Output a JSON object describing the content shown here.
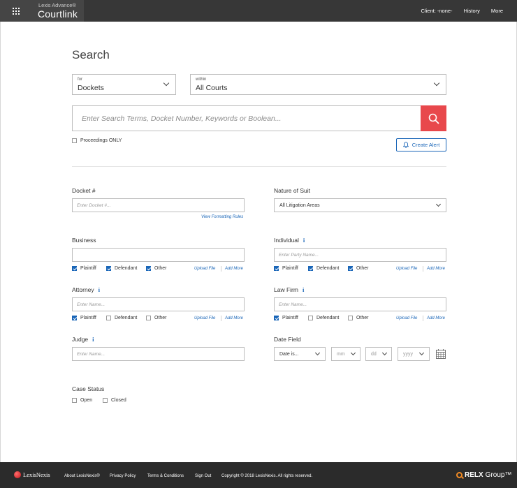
{
  "header": {
    "brand_sup": "Lexis Advance®",
    "brand_main": "Courtlink",
    "nav": [
      "Client: -none-",
      "History",
      "More"
    ]
  },
  "search": {
    "title": "Search",
    "for_label": "for",
    "for_value": "Dockets",
    "within_label": "within",
    "within_value": "All Courts",
    "placeholder": "Enter Search Terms, Docket Number, Keywords or Boolean...",
    "proceedings_only": "Proceedings ONLY",
    "create_alert": "Create Alert"
  },
  "form": {
    "docket": {
      "label": "Docket #",
      "placeholder": "Enter Docket #...",
      "link": "View Formatting Rules"
    },
    "nature": {
      "label": "Nature of Suit",
      "value": "All Litigation Areas"
    },
    "business": {
      "label": "Business",
      "placeholder": "",
      "plaintiff": "Plaintiff",
      "defendant": "Defendant",
      "other": "Other",
      "upload": "Upload File",
      "add": "Add More"
    },
    "individual": {
      "label": "Individual",
      "placeholder": "Enter Party Name...",
      "plaintiff": "Plaintiff",
      "defendant": "Defendant",
      "other": "Other",
      "upload": "Upload File",
      "add": "Add More"
    },
    "attorney": {
      "label": "Attorney",
      "placeholder": "Enter Name...",
      "plaintiff": "Plaintiff",
      "defendant": "Defendant",
      "other": "Other",
      "upload": "Upload File",
      "add": "Add More"
    },
    "lawfirm": {
      "label": "Law Firm",
      "placeholder": "Enter Name...",
      "plaintiff": "Plaintiff",
      "defendant": "Defendant",
      "other": "Other",
      "upload": "Upload File",
      "add": "Add More"
    },
    "judge": {
      "label": "Judge",
      "placeholder": "Enter Name..."
    },
    "datefield": {
      "label": "Date Field",
      "type": "Date is...",
      "mm": "mm",
      "dd": "dd",
      "yyyy": "yyyy"
    },
    "casestatus": {
      "label": "Case Status",
      "open": "Open",
      "closed": "Closed"
    },
    "info_glyph": "i"
  },
  "footer": {
    "logo": "LexisNexis",
    "links": [
      "About LexisNexis®",
      "Privacy Policy",
      "Terms & Conditions",
      "Sign Out",
      "Copyright © 2018 LexisNexis. All rights reserved."
    ],
    "relx_bold": "RELX",
    "relx_light": "Group™"
  },
  "colors": {
    "accent": "#1a66b8",
    "search_button": "#e8484c",
    "header_bg": "#373737",
    "footer_bg": "#2b2b2b"
  }
}
